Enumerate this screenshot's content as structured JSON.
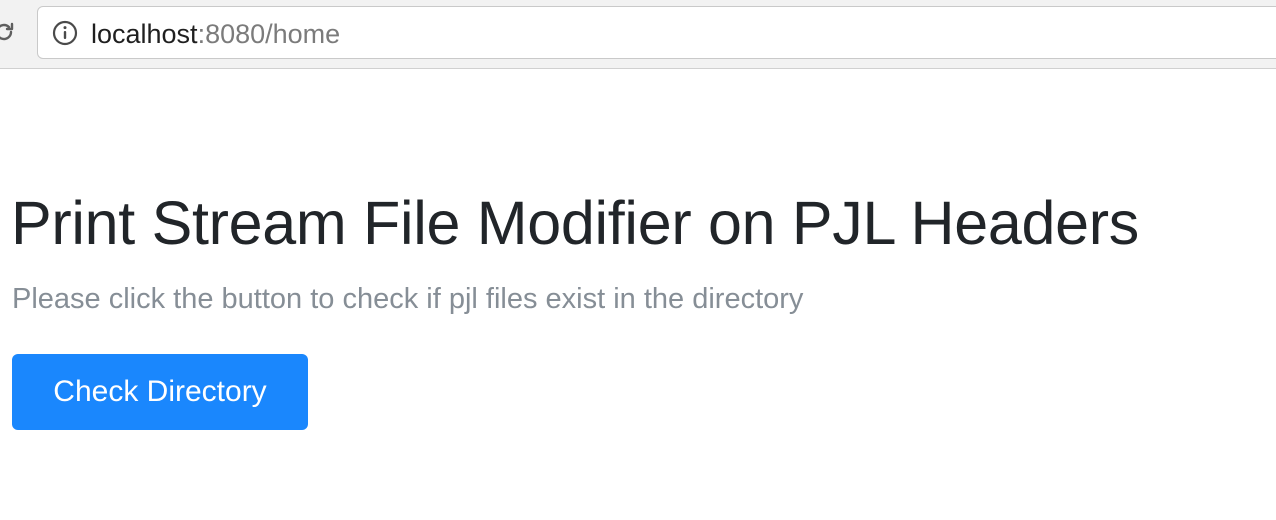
{
  "browser": {
    "url_host": "localhost",
    "url_rest": ":8080/home",
    "icons": {
      "reload": "reload-icon",
      "site_info": "info-icon"
    }
  },
  "page": {
    "title": "Print Stream File Modifier on PJL Headers",
    "lead": "Please click the button to check if pjl files exist in the directory",
    "button_label": "Check Directory"
  },
  "colors": {
    "button_bg": "#1a87fd",
    "title_text": "#212529",
    "lead_text": "#868e96"
  }
}
